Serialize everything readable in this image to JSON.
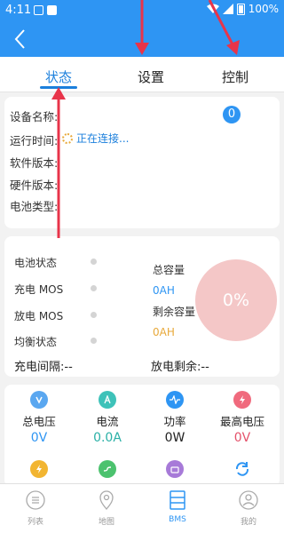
{
  "status_bar": {
    "time": "4:11",
    "battery": "100%"
  },
  "tabs": [
    {
      "label": "状态",
      "active": true
    },
    {
      "label": "设置",
      "active": false
    },
    {
      "label": "控制",
      "active": false
    }
  ],
  "device_info": {
    "rows": [
      "设备名称:",
      "运行时间:",
      "软件版本:",
      "硬件版本:",
      "电池类型:"
    ],
    "connecting_text": "正在连接...",
    "count": "0"
  },
  "battery_status": {
    "labels": [
      "电池状态",
      "充电 MOS",
      "放电 MOS",
      "均衡状态"
    ],
    "total_capacity_label": "总容量",
    "total_capacity_value": "0AH",
    "remaining_capacity_label": "剩余容量",
    "remaining_capacity_value": "0AH",
    "soc": "0%",
    "charge_interval": "充电间隔:--",
    "discharge_remaining": "放电剩余:--"
  },
  "metrics": [
    {
      "label": "总电压",
      "value": "0V",
      "icon": "voltage-icon",
      "color": "#5aa7f0",
      "value_color": "#2e95f3"
    },
    {
      "label": "电流",
      "value": "0.0A",
      "icon": "current-icon",
      "color": "#3ec2b9",
      "value_color": "#2ab0a6"
    },
    {
      "label": "功率",
      "value": "0W",
      "icon": "power-icon",
      "color": "#2e95f3",
      "value_color": "#222222"
    },
    {
      "label": "最高电压",
      "value": "0V",
      "icon": "max-voltage-icon",
      "color": "#f06a7d",
      "value_color": "#e4516a"
    }
  ],
  "metrics_row2_icons": [
    "bolt-icon",
    "swap-icon",
    "battery-cell-icon",
    "refresh-icon"
  ],
  "bottom_nav": [
    {
      "label": "列表",
      "icon": "list-icon",
      "active": false
    },
    {
      "label": "地图",
      "icon": "map-pin-icon",
      "active": false
    },
    {
      "label": "BMS",
      "icon": "bms-icon",
      "active": true
    },
    {
      "label": "我的",
      "icon": "profile-icon",
      "active": false
    }
  ],
  "colors": {
    "primary": "#2e95f3",
    "capacity_total": "#2e95f3",
    "capacity_remaining": "#e8a93a",
    "gauge": "#f4c7c7",
    "annotation_arrow": "#e8344a"
  }
}
